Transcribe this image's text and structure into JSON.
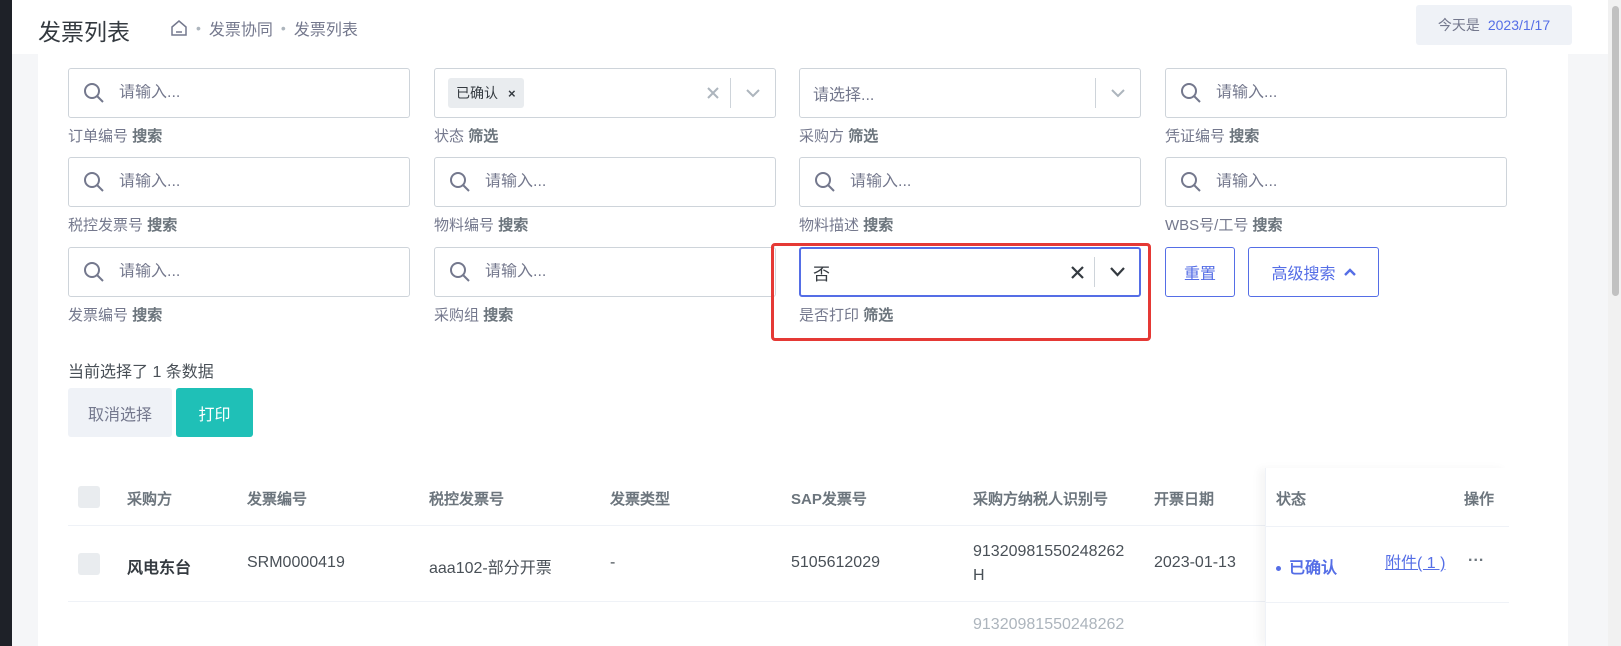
{
  "header": {
    "title": "发票列表",
    "breadcrumb": [
      "发票协同",
      "发票列表"
    ],
    "date_label": "今天是",
    "date_value": "2023/1/17"
  },
  "filters": {
    "placeholder_input": "请输入...",
    "placeholder_select": "请选择...",
    "order_no": {
      "label": "订单编号",
      "action": "搜索"
    },
    "status": {
      "label": "状态",
      "action": "筛选",
      "tag": "已确认",
      "tag_remove": "×"
    },
    "buyer": {
      "label": "采购方",
      "action": "筛选"
    },
    "voucher_no": {
      "label": "凭证编号",
      "action": "搜索"
    },
    "tax_invoice_no": {
      "label": "税控发票号",
      "action": "搜索"
    },
    "material_no": {
      "label": "物料编号",
      "action": "搜索"
    },
    "material_desc": {
      "label": "物料描述",
      "action": "搜索"
    },
    "wbs_no": {
      "label": "WBS号/工号",
      "action": "搜索"
    },
    "invoice_no": {
      "label": "发票编号",
      "action": "搜索"
    },
    "purchase_group": {
      "label": "采购组",
      "action": "搜索"
    },
    "printed": {
      "label": "是否打印",
      "action": "筛选",
      "value": "否"
    },
    "reset_label": "重置",
    "advanced_label": "高级搜索"
  },
  "selection": {
    "text": "当前选择了 1 条数据",
    "cancel_label": "取消选择",
    "print_label": "打印"
  },
  "table": {
    "headers": [
      "采购方",
      "发票编号",
      "税控发票号",
      "发票类型",
      "SAP发票号",
      "采购方纳税人识别号",
      "开票日期",
      "状态",
      "操作"
    ],
    "rows": [
      {
        "buyer": "风电东台",
        "invoice_no": "SRM0000419",
        "tax_invoice_no": "aaa102-部分开票",
        "invoice_type": "-",
        "sap_no": "5105612029",
        "taxpayer_id_1": "91320981550248262",
        "taxpayer_id_2": "H",
        "date": "2023-01-13",
        "status": "已确认",
        "attachment": "附件( 1 )",
        "more": "..."
      }
    ],
    "next_row_partial": "91320981550248262"
  },
  "colors": {
    "primary": "#556ee6",
    "teal": "#1fc0b7",
    "highlight": "#e53935"
  }
}
